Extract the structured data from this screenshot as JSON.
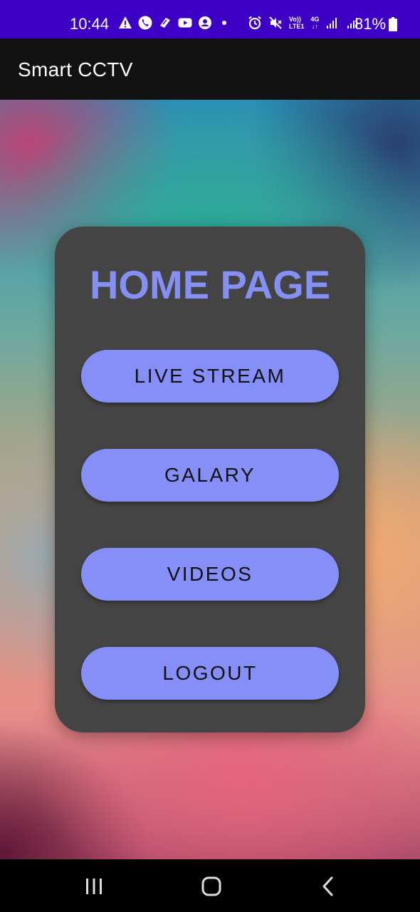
{
  "status_bar": {
    "time": "10:44",
    "battery": "81%",
    "left_icons": [
      "warning-icon",
      "phone-call-icon",
      "app-notification-icon",
      "youtube-icon",
      "account-icon"
    ],
    "right_icons": [
      "alarm-icon",
      "mute-icon",
      "volte-icon",
      "4g-data-icon",
      "signal-icon",
      "signal-icon",
      "battery-icon"
    ],
    "volte_label_top": "Vo))",
    "volte_label_bottom": "LTE1",
    "data_label": "4G",
    "color": "#3d00c4"
  },
  "app_bar": {
    "title": "Smart CCTV"
  },
  "card": {
    "title": "HOME PAGE",
    "buttons": [
      {
        "label": "LIVE STREAM"
      },
      {
        "label": "GALARY"
      },
      {
        "label": "VIDEOS"
      },
      {
        "label": "LOGOUT"
      }
    ]
  },
  "colors": {
    "accent": "#868ef8",
    "title": "#8590f5",
    "card": "#444444"
  },
  "nav_bar": {
    "items": [
      "recent-apps-icon",
      "home-icon",
      "back-icon"
    ]
  }
}
